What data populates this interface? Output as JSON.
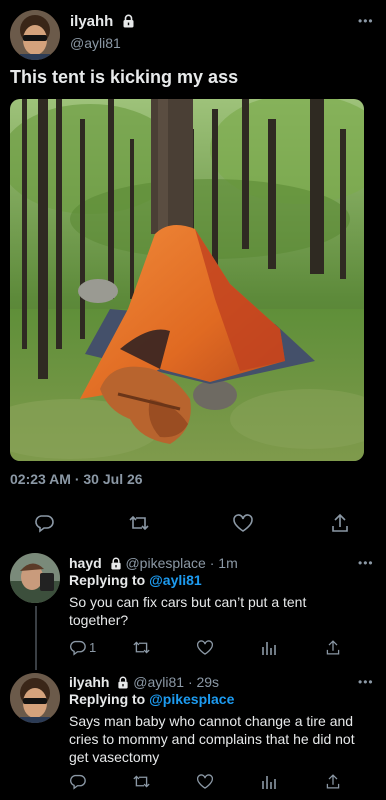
{
  "main_tweet": {
    "author_name": "ilyahh",
    "author_handle": "@ayli81",
    "text": "This tent is kicking my ass",
    "timestamp": "02:23 AM · 30 Jul 26",
    "more_icon": "ellipsis-icon",
    "lock_icon": "lock-icon"
  },
  "replies": [
    {
      "author_name": "hayd",
      "author_handle": "@pikesplace",
      "time": "· 1m",
      "replying_prefix": "Replying to ",
      "replying_handle": "@ayli81",
      "text": "So you can fix cars but can’t put a tent together?",
      "reply_count": "1"
    },
    {
      "author_name": "ilyahh",
      "author_handle": "@ayli81",
      "time": "· 29s",
      "replying_prefix": "Replying to ",
      "replying_handle": "@pikesplace",
      "text": "Says man baby who cannot change a tire and cries to mommy and complains that he did not get vasectomy",
      "reply_count": ""
    }
  ],
  "colors": {
    "background": "#000000",
    "text": "#e7e9ea",
    "muted": "#8b98a5",
    "link": "#1d9bf0",
    "tent_orange": "#e8742a"
  }
}
